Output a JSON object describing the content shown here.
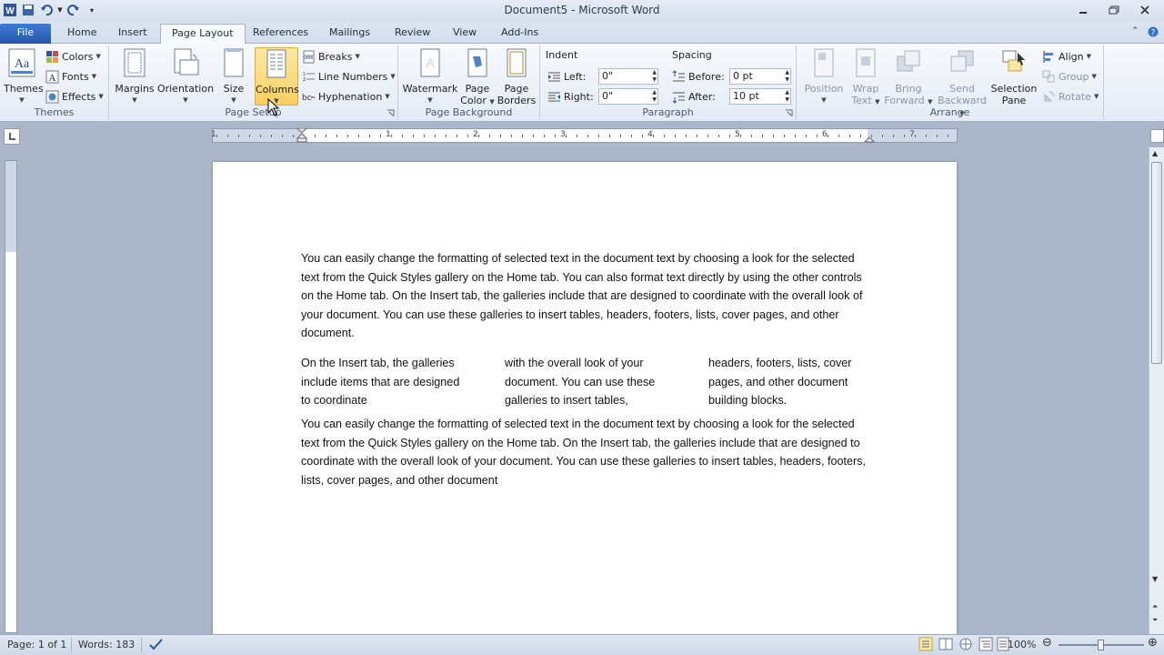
{
  "window": {
    "title": "Document5 - Microsoft Word"
  },
  "tabs": [
    {
      "label": "File"
    },
    {
      "label": "Home"
    },
    {
      "label": "Insert"
    },
    {
      "label": "Page Layout"
    },
    {
      "label": "References"
    },
    {
      "label": "Mailings"
    },
    {
      "label": "Review"
    },
    {
      "label": "View"
    },
    {
      "label": "Add-Ins"
    }
  ],
  "ribbon": {
    "themes": {
      "themes_label": "Themes",
      "colors": "Colors",
      "fonts": "Fonts",
      "effects": "Effects",
      "group": "Themes"
    },
    "page_setup": {
      "margins": "Margins",
      "orientation": "Orientation",
      "size": "Size",
      "columns": "Columns",
      "breaks": "Breaks",
      "line_numbers": "Line Numbers",
      "hyphenation": "Hyphenation",
      "group": "Page Setup"
    },
    "page_background": {
      "watermark": "Watermark",
      "page_color_1": "Page",
      "page_color_2": "Color",
      "page_borders_1": "Page",
      "page_borders_2": "Borders",
      "group": "Page Background"
    },
    "paragraph": {
      "indent": "Indent",
      "left_label": "Left:",
      "left_value": "0\"",
      "right_label": "Right:",
      "right_value": "0\"",
      "spacing": "Spacing",
      "before_label": "Before:",
      "before_value": "0 pt",
      "after_label": "After:",
      "after_value": "10 pt",
      "group": "Paragraph"
    },
    "arrange": {
      "position": "Position",
      "wrap_1": "Wrap",
      "wrap_2": "Text",
      "bring_1": "Bring",
      "bring_2": "Forward",
      "send_1": "Send",
      "send_2": "Backward",
      "sel_1": "Selection",
      "sel_2": "Pane",
      "align": "Align",
      "group_btn": "Group",
      "rotate": "Rotate",
      "group": "Arrange"
    }
  },
  "ruler": {
    "numbers": [
      "1",
      "1",
      "2",
      "3",
      "4",
      "5",
      "6",
      "7"
    ]
  },
  "document": {
    "para1": "You can easily change the formatting of selected text in the document text by choosing a look for the selected text from the Quick Styles gallery on the Home tab. You can also format text directly by using the other controls on the Home tab. On the Insert tab, the galleries include that are designed to coordinate with the overall look of your document. You can use these galleries to insert tables, headers, footers, lists, cover pages, and other document.",
    "col1": "On the Insert tab, the galleries include items that are designed to coordinate",
    "col2": "with the overall look of your document. You can use these galleries to insert tables,",
    "col3": "headers, footers, lists, cover pages, and other document building blocks.",
    "para2": "You can easily change the formatting of selected text in the document text by choosing a look for the selected text from the Quick Styles gallery on the Home tab. On the Insert tab, the galleries include that are designed to coordinate with the overall look of your document. You can use these galleries to insert tables, headers, footers, lists, cover pages, and other document"
  },
  "status": {
    "page": "Page: 1 of 1",
    "words": "Words: 183",
    "zoom": "100%"
  }
}
